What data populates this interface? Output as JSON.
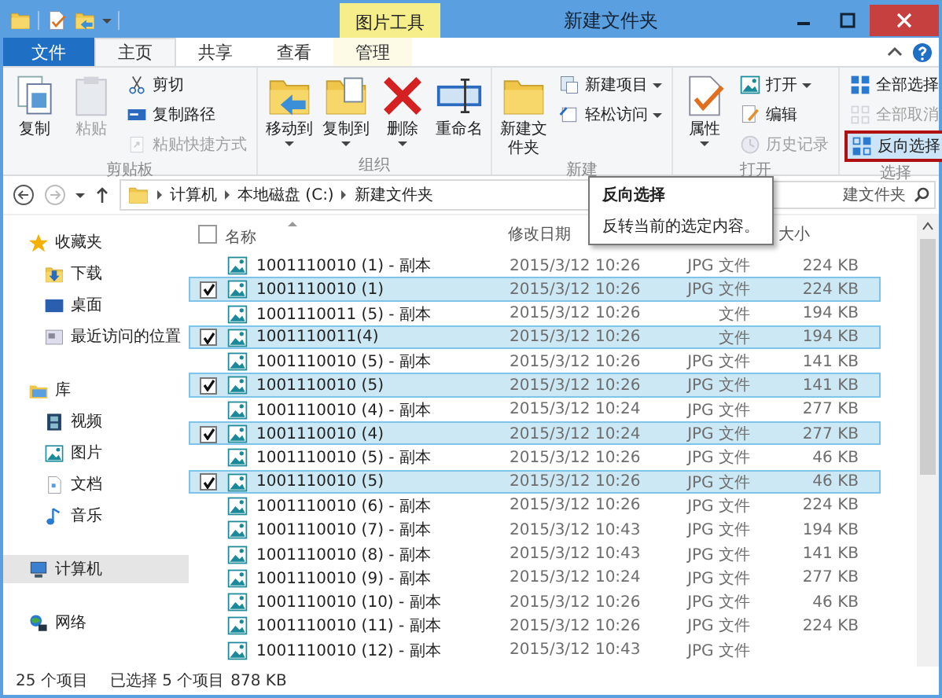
{
  "window": {
    "title": "新建文件夹"
  },
  "context_tab": {
    "label": "图片工具"
  },
  "tabs": [
    {
      "label": "文件",
      "kind": "file",
      "selected": false
    },
    {
      "label": "主页",
      "kind": "normal",
      "selected": true
    },
    {
      "label": "共享",
      "kind": "normal",
      "selected": false
    },
    {
      "label": "查看",
      "kind": "normal",
      "selected": false
    },
    {
      "label": "管理",
      "kind": "context",
      "selected": false
    }
  ],
  "ribbon": {
    "groups": [
      {
        "label": "剪贴板",
        "items": [
          {
            "label": "复制",
            "kind": "large",
            "disabled": false,
            "dropdown": false,
            "highlighted": false
          },
          {
            "label": "粘贴",
            "kind": "large",
            "disabled": true,
            "dropdown": false,
            "highlighted": false
          },
          {
            "label": "剪切",
            "kind": "small",
            "disabled": false,
            "dropdown": false,
            "highlighted": false
          },
          {
            "label": "复制路径",
            "kind": "small",
            "disabled": false,
            "dropdown": false,
            "highlighted": false
          },
          {
            "label": "粘贴快捷方式",
            "kind": "small",
            "disabled": true,
            "dropdown": false,
            "highlighted": false
          }
        ]
      },
      {
        "label": "组织",
        "items": [
          {
            "label": "移动到",
            "kind": "large",
            "disabled": false,
            "dropdown": true,
            "highlighted": false
          },
          {
            "label": "复制到",
            "kind": "large",
            "disabled": false,
            "dropdown": true,
            "highlighted": false
          },
          {
            "label": "删除",
            "kind": "large",
            "disabled": false,
            "dropdown": true,
            "highlighted": false
          },
          {
            "label": "重命名",
            "kind": "large",
            "disabled": false,
            "dropdown": false,
            "highlighted": false
          }
        ]
      },
      {
        "label": "新建",
        "items": [
          {
            "label": "新建文件夹",
            "kind": "large",
            "disabled": false,
            "dropdown": false,
            "highlighted": false
          },
          {
            "label": "新建项目",
            "kind": "small",
            "disabled": false,
            "dropdown": true,
            "highlighted": false
          },
          {
            "label": "轻松访问",
            "kind": "small",
            "disabled": false,
            "dropdown": true,
            "highlighted": false
          }
        ]
      },
      {
        "label": "打开",
        "items": [
          {
            "label": "属性",
            "kind": "large",
            "disabled": false,
            "dropdown": true,
            "highlighted": false
          },
          {
            "label": "打开",
            "kind": "small",
            "disabled": false,
            "dropdown": true,
            "highlighted": false
          },
          {
            "label": "编辑",
            "kind": "small",
            "disabled": false,
            "dropdown": false,
            "highlighted": false
          },
          {
            "label": "历史记录",
            "kind": "small",
            "disabled": true,
            "dropdown": false,
            "highlighted": false
          }
        ]
      },
      {
        "label": "选择",
        "items": [
          {
            "label": "全部选择",
            "kind": "small",
            "disabled": false,
            "dropdown": false,
            "highlighted": false
          },
          {
            "label": "全部取消",
            "kind": "small",
            "disabled": true,
            "dropdown": false,
            "highlighted": false
          },
          {
            "label": "反向选择",
            "kind": "small",
            "disabled": false,
            "dropdown": false,
            "highlighted": true
          }
        ]
      }
    ]
  },
  "address_bar": {
    "path": [
      "计算机",
      "本地磁盘 (C:)",
      "新建文件夹"
    ]
  },
  "search": {
    "placeholder": "建文件夹"
  },
  "tooltip": {
    "title": "反向选择",
    "text": "反转当前的选定内容。"
  },
  "sidebar": {
    "groups": [
      {
        "label": "收藏夹",
        "selected": false,
        "children": [
          {
            "label": "下载",
            "selected": false
          },
          {
            "label": "桌面",
            "selected": false
          },
          {
            "label": "最近访问的位置",
            "selected": false
          }
        ]
      },
      {
        "label": "库",
        "selected": false,
        "children": [
          {
            "label": "视频",
            "selected": false
          },
          {
            "label": "图片",
            "selected": false
          },
          {
            "label": "文档",
            "selected": false
          },
          {
            "label": "音乐",
            "selected": false
          }
        ]
      },
      {
        "label": "计算机",
        "selected": true
      },
      {
        "label": "网络",
        "selected": false
      }
    ]
  },
  "files": {
    "header_checked": false,
    "columns": [
      "名称",
      "修改日期",
      "大小"
    ],
    "rows": [
      {
        "name": "1001110010 (1) - 副本",
        "date": "2015/3/12 10:26",
        "type": "JPG 文件",
        "size": "224 KB",
        "selected": false
      },
      {
        "name": "1001110010 (1)",
        "date": "2015/3/12 10:26",
        "type": "JPG 文件",
        "size": "224 KB",
        "selected": true
      },
      {
        "name": "1001110011 (5) - 副本",
        "date": "2015/3/12 10:26",
        "type": "文件",
        "size": "194 KB",
        "selected": false
      },
      {
        "name": "1001110011(4)",
        "date": "2015/3/12 10:26",
        "type": "文件",
        "size": "194 KB",
        "selected": true
      },
      {
        "name": "1001110010 (5) - 副本",
        "date": "2015/3/12 10:26",
        "type": "JPG 文件",
        "size": "141 KB",
        "selected": false
      },
      {
        "name": "1001110010 (5)",
        "date": "2015/3/12 10:26",
        "type": "JPG 文件",
        "size": "141 KB",
        "selected": true
      },
      {
        "name": "1001110010 (4) - 副本",
        "date": "2015/3/12 10:24",
        "type": "JPG 文件",
        "size": "277 KB",
        "selected": false
      },
      {
        "name": "1001110010 (4)",
        "date": "2015/3/12 10:24",
        "type": "JPG 文件",
        "size": "277 KB",
        "selected": true
      },
      {
        "name": "1001110010 (5) - 副本",
        "date": "2015/3/12 10:26",
        "type": "JPG 文件",
        "size": "46 KB",
        "selected": false
      },
      {
        "name": "1001110010 (5)",
        "date": "2015/3/12 10:26",
        "type": "JPG 文件",
        "size": "46 KB",
        "selected": true
      },
      {
        "name": "1001110010 (6) - 副本",
        "date": "2015/3/12 10:26",
        "type": "JPG 文件",
        "size": "224 KB",
        "selected": false
      },
      {
        "name": "1001110010 (7) - 副本",
        "date": "2015/3/12 10:43",
        "type": "JPG 文件",
        "size": "194 KB",
        "selected": false
      },
      {
        "name": "1001110010 (8) - 副本",
        "date": "2015/3/12 10:43",
        "type": "JPG 文件",
        "size": "141 KB",
        "selected": false
      },
      {
        "name": "1001110010 (9) - 副本",
        "date": "2015/3/12 10:24",
        "type": "JPG 文件",
        "size": "277 KB",
        "selected": false
      },
      {
        "name": "1001110010 (10) - 副本",
        "date": "2015/3/12 10:26",
        "type": "JPG 文件",
        "size": "46 KB",
        "selected": false
      },
      {
        "name": "1001110010 (11) - 副本",
        "date": "2015/3/12 10:26",
        "type": "JPG 文件",
        "size": "224 KB",
        "selected": false
      },
      {
        "name": "1001110010 (12) - 副本",
        "date": "2015/3/12 10:43",
        "type": "JPG 文件",
        "selected": false
      }
    ]
  },
  "status_bar": {
    "count": "25 个项目",
    "selection": "已选择 5 个项目",
    "selection_size": "878 KB"
  }
}
